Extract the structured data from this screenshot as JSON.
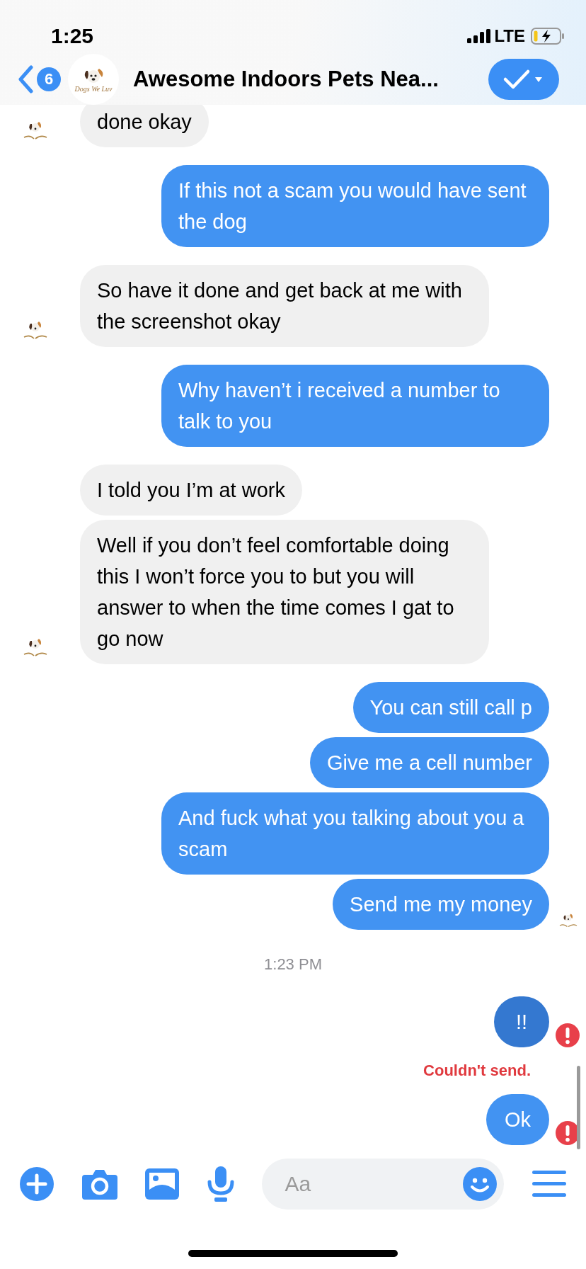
{
  "status_bar": {
    "time": "1:25",
    "network": "LTE"
  },
  "header": {
    "unread_count": "6",
    "avatar_text": "Dogs We Luv",
    "title": "Awesome Indoors Pets Nea..."
  },
  "messages": [
    {
      "kind": "received",
      "text": "done okay",
      "avatar": true
    },
    {
      "kind": "sent",
      "text": "If this not a scam you would have sent the dog",
      "selected": false,
      "failed": false,
      "seen": false
    },
    {
      "kind": "received",
      "text": "So have it done and get back at me with the screenshot okay",
      "avatar": true
    },
    {
      "kind": "sent",
      "text": "Why haven’t i received a number to talk to you",
      "selected": false,
      "failed": false,
      "seen": false
    },
    {
      "kind": "received",
      "text": "I told you I’m at work",
      "avatar": false
    },
    {
      "kind": "received",
      "text": "Well if you don’t feel comfortable doing this I won’t force you to but you will answer to when the time comes I gat to go now",
      "avatar": true
    },
    {
      "kind": "sent",
      "text": "You can still call p",
      "selected": false,
      "failed": false,
      "seen": false
    },
    {
      "kind": "sent",
      "text": "Give me a cell number",
      "selected": false,
      "failed": false,
      "seen": false
    },
    {
      "kind": "sent",
      "text": "And fuck what you talking about you a scam",
      "selected": false,
      "failed": false,
      "seen": false
    },
    {
      "kind": "sent",
      "text": "Send me my money",
      "selected": false,
      "failed": false,
      "seen": true
    },
    {
      "kind": "time",
      "text": "1:23 PM"
    },
    {
      "kind": "sent",
      "text": "!!",
      "selected": true,
      "failed": true,
      "seen": false
    },
    {
      "kind": "error",
      "text": "Couldn't send."
    },
    {
      "kind": "sent",
      "text": "Ok",
      "selected": false,
      "failed": true,
      "seen": false
    }
  ],
  "composer": {
    "placeholder": "Aa"
  }
}
